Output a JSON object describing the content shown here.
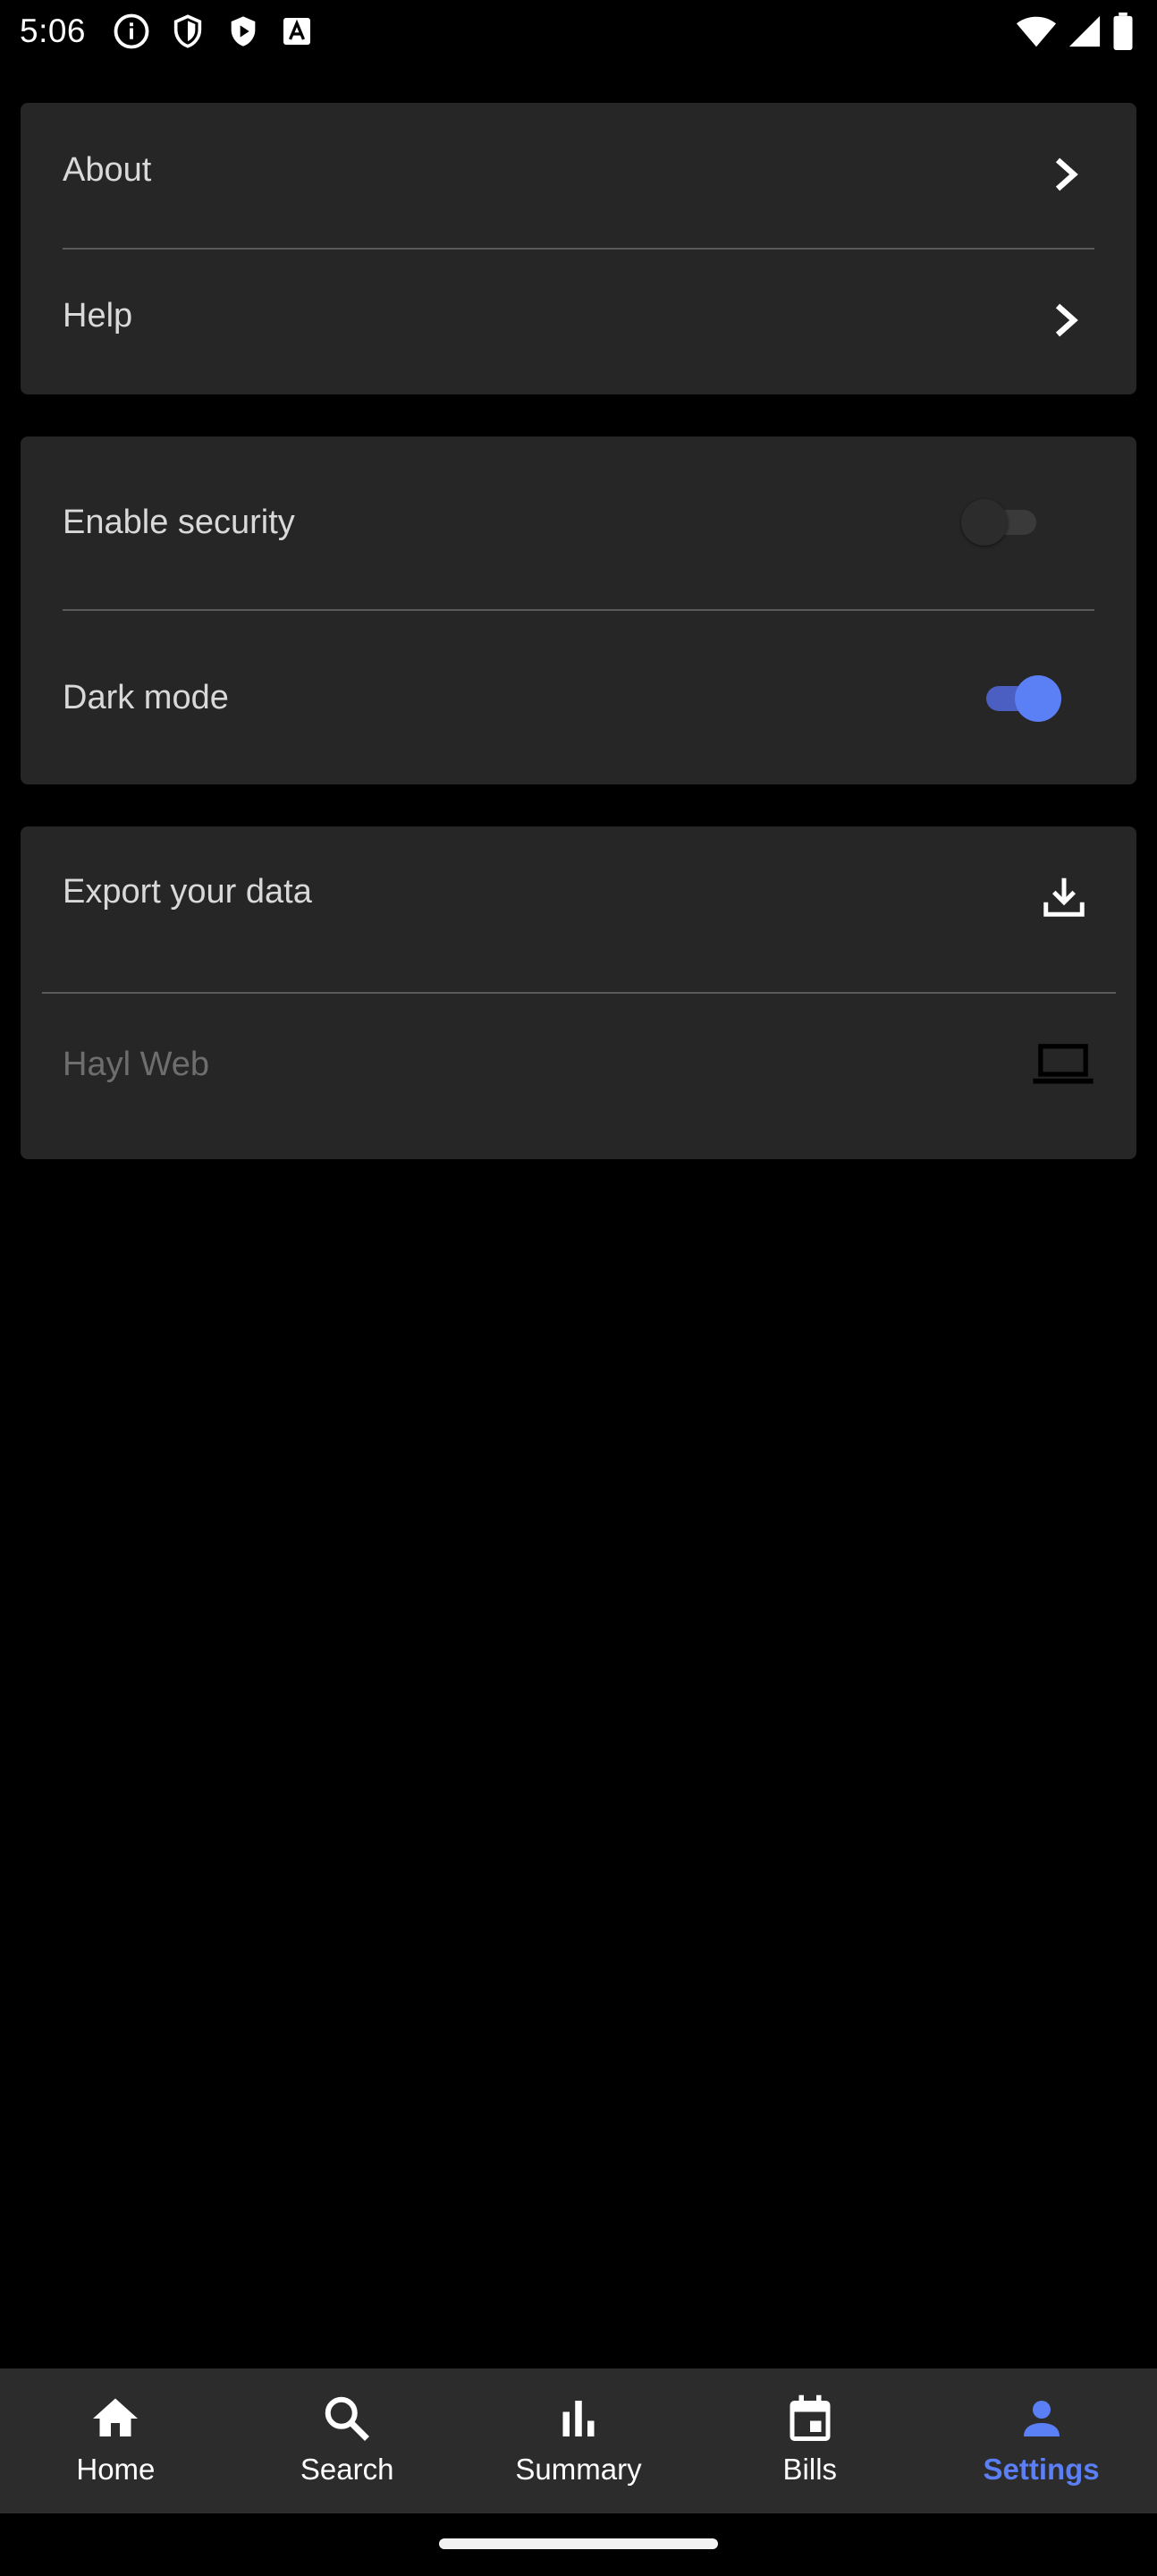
{
  "status_bar": {
    "time": "5:06",
    "left_icons": [
      "info-icon",
      "shield-icon",
      "play-store-icon",
      "text-icon"
    ],
    "right_icons": [
      "wifi-icon",
      "signal-icon",
      "battery-icon"
    ]
  },
  "sections": {
    "info": {
      "about_label": "About",
      "help_label": "Help"
    },
    "preferences": {
      "security_label": "Enable security",
      "security_enabled": false,
      "dark_mode_label": "Dark mode",
      "dark_mode_enabled": true
    },
    "data": {
      "export_label": "Export your data",
      "web_label": "Hayl Web"
    }
  },
  "bottom_nav": {
    "items": [
      {
        "label": "Home",
        "icon": "home-icon",
        "active": false
      },
      {
        "label": "Search",
        "icon": "search-icon",
        "active": false
      },
      {
        "label": "Summary",
        "icon": "bar-chart-icon",
        "active": false
      },
      {
        "label": "Bills",
        "icon": "calendar-icon",
        "active": false
      },
      {
        "label": "Settings",
        "icon": "person-icon",
        "active": true
      }
    ]
  },
  "colors": {
    "accent": "#5b7ff5",
    "card_background": "#262626",
    "page_background": "#000000",
    "nav_background": "#2c2c2c"
  }
}
